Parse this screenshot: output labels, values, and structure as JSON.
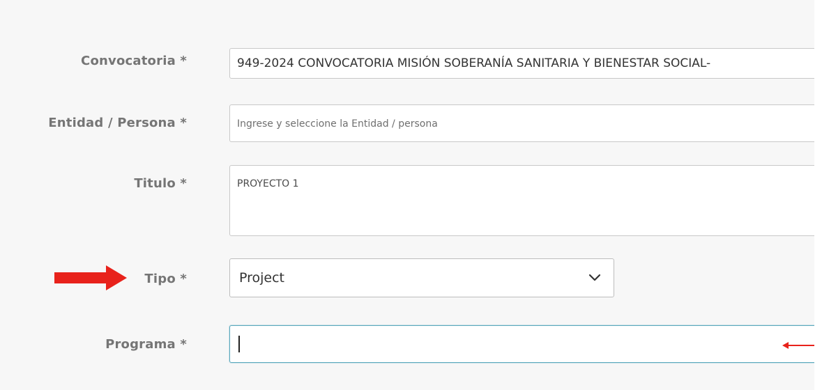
{
  "form": {
    "convocatoria": {
      "label": "Convocatoria *",
      "value": "949-2024 CONVOCATORIA MISIÓN SOBERANÍA SANITARIA Y BIENESTAR SOCIAL-"
    },
    "entidad": {
      "label": "Entidad / Persona *",
      "placeholder": "Ingrese y seleccione la Entidad / persona"
    },
    "titulo": {
      "label": "Titulo *",
      "value": "PROYECTO 1"
    },
    "tipo": {
      "label": "Tipo *",
      "selected": "Project"
    },
    "programa": {
      "label": "Programa *",
      "value": ""
    }
  },
  "colors": {
    "panel_background": "#f7f7f7",
    "label_text": "#757575",
    "focus_border": "#5aa9bd",
    "annotation_arrow": "#e8221b"
  },
  "icons": {
    "tipo_dropdown": "chevron-down-icon",
    "annotation": "red-arrow-icon"
  }
}
